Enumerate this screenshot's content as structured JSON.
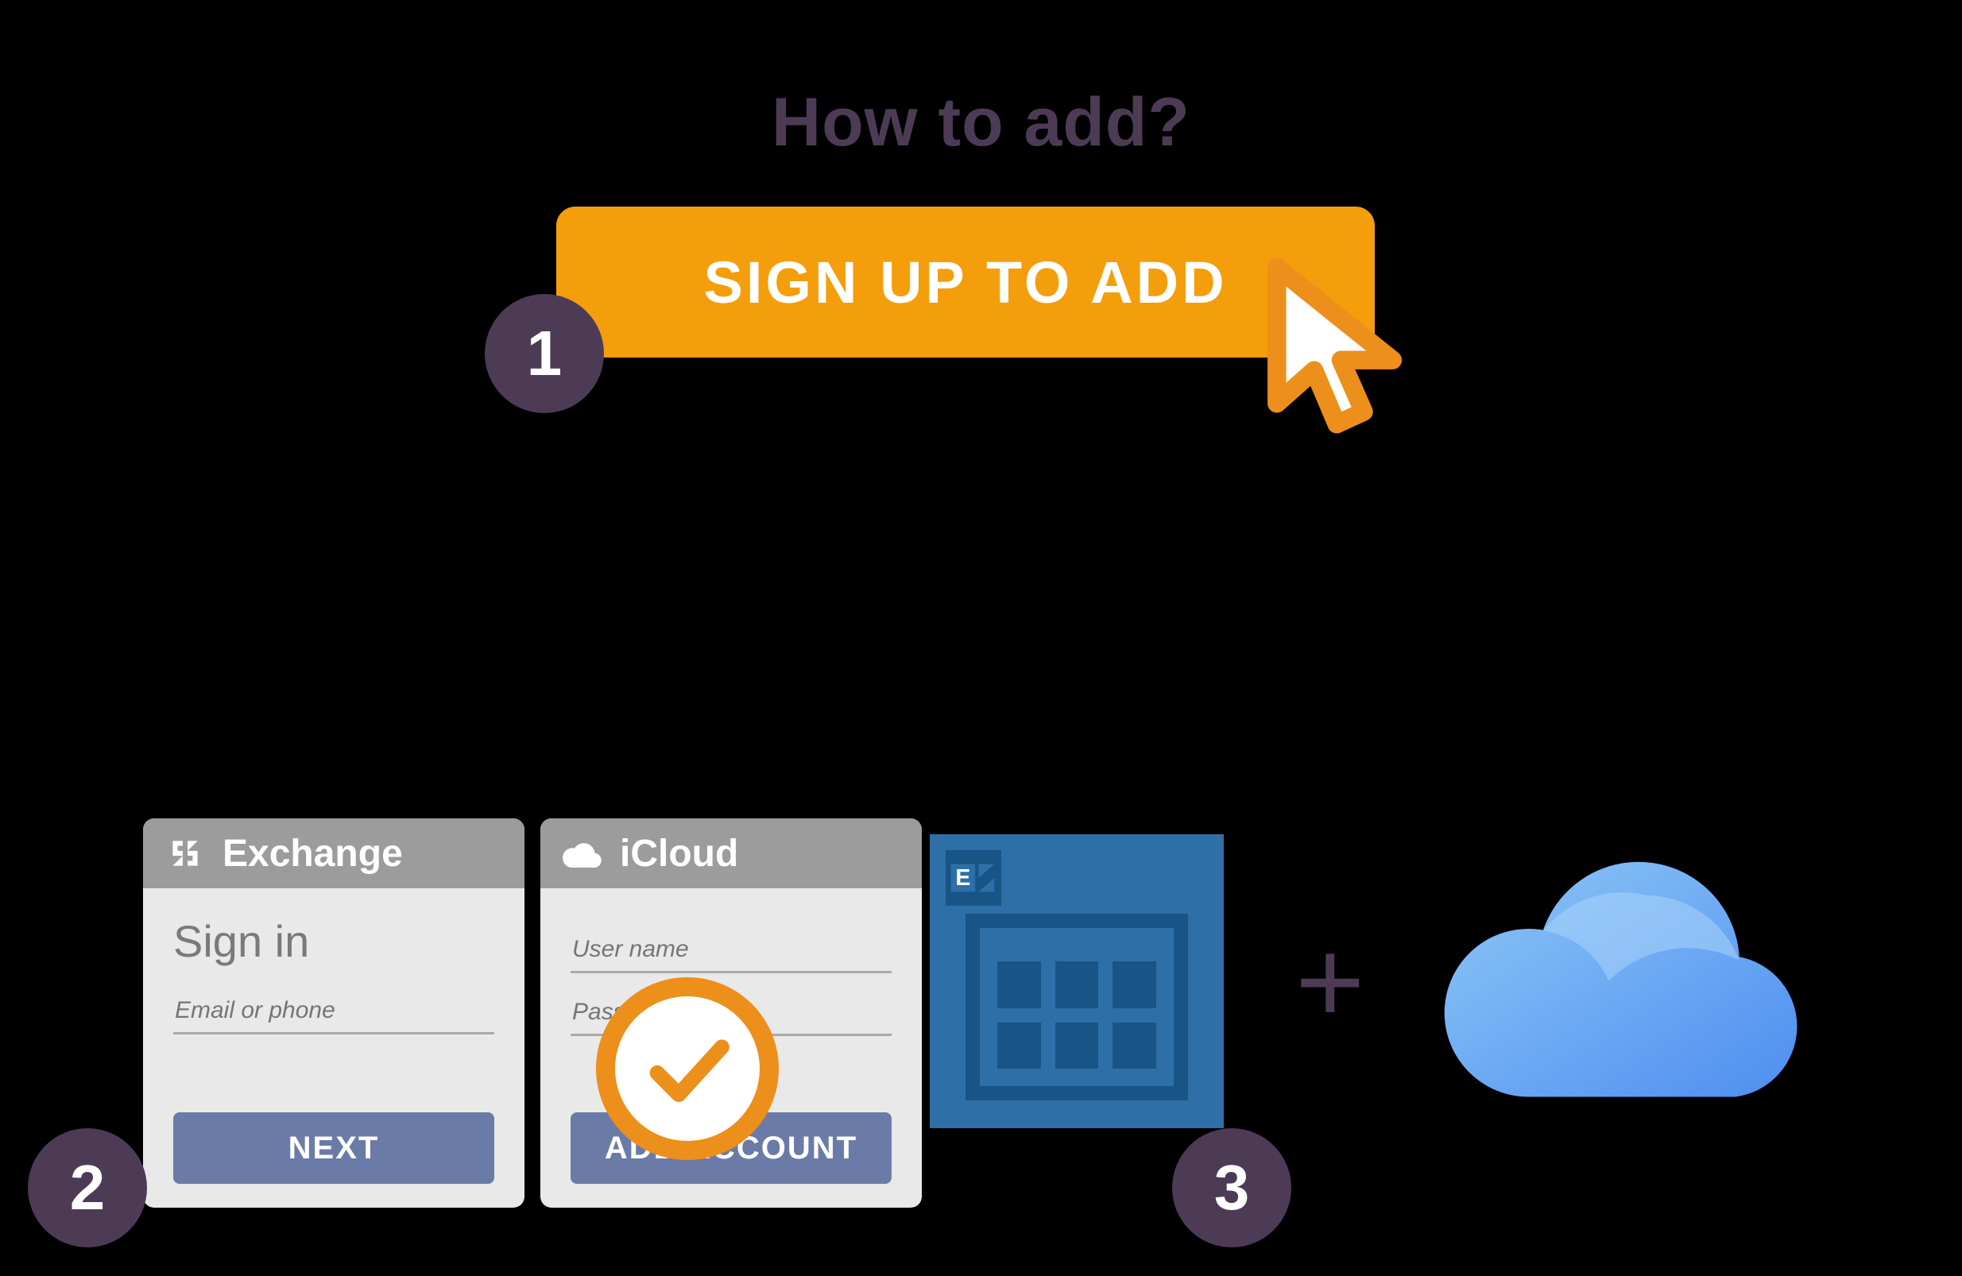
{
  "title": "How to add?",
  "steps": {
    "s1": {
      "num": "1",
      "button_label": "SIGN UP TO ADD"
    },
    "s2": {
      "num": "2",
      "exchange": {
        "header": "Exchange",
        "heading": "Sign in",
        "field1_placeholder": "Email or phone",
        "button_label": "NEXT"
      },
      "icloud": {
        "header": "iCloud",
        "field1_placeholder": "User name",
        "field2_placeholder": "Password",
        "button_label": "ADD ACCOUNT"
      }
    },
    "s3": {
      "num": "3",
      "plus": "+"
    }
  }
}
